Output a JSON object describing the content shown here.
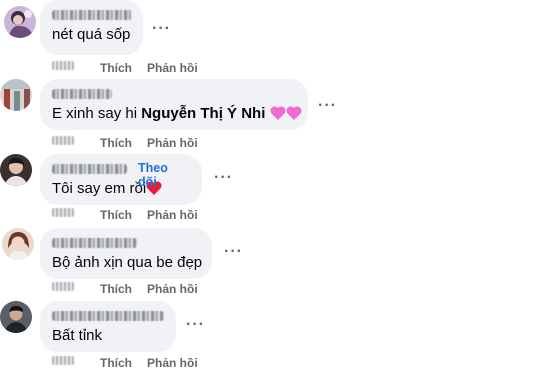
{
  "comments": [
    {
      "text": "nét quá sốp",
      "actions": {
        "like": "Thích",
        "reply": "Phản hồi"
      },
      "more_icon": "ellipsis-icon"
    },
    {
      "text_prefix": "E xinh say hi ",
      "mention": "Nguyễn Thị Ý Nhi",
      "emoji": "pink-hearts-icon",
      "actions": {
        "like": "Thích",
        "reply": "Phản hồi"
      },
      "more_icon": "ellipsis-icon"
    },
    {
      "follow_label": "Theo dõi",
      "text": "Tôi say em rồi",
      "emoji": "red-heart-icon",
      "actions": {
        "like": "Thích",
        "reply": "Phản hồi"
      },
      "more_icon": "ellipsis-icon"
    },
    {
      "text": "Bộ ảnh xịn qua be đẹp",
      "actions": {
        "like": "Thích",
        "reply": "Phản hồi"
      },
      "more_icon": "ellipsis-icon"
    },
    {
      "text": "Bất tỉnk",
      "actions": {
        "like": "Thích",
        "reply": "Phản hồi"
      },
      "more_icon": "ellipsis-icon"
    }
  ],
  "colors": {
    "bubble": "#f0f2f5",
    "text": "#050505",
    "secondary": "#65676b",
    "link": "#216fdb",
    "pink_heart": "#f06bd1",
    "red_heart": "#e41e3f"
  }
}
